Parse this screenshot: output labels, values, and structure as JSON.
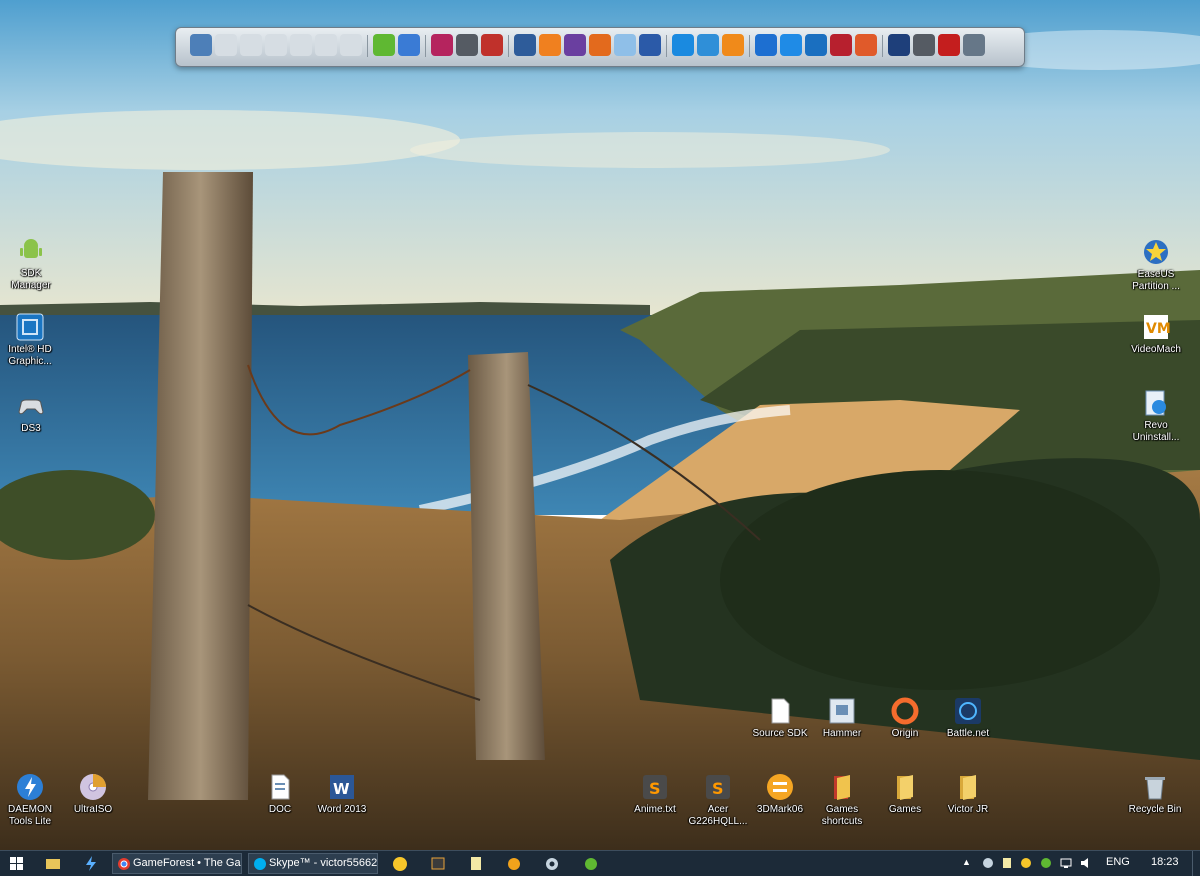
{
  "dock": {
    "icons": [
      "computer-icon",
      "drive-icon",
      "drive-icon",
      "drive-icon",
      "drive-icon",
      "drive-icon",
      "drive-icon",
      "utorrent-icon",
      "thunderbird-icon",
      "winamp-icon",
      "steam-icon",
      "anydvd-icon",
      "virtualbox-icon",
      "xampp-icon",
      "visual-studio-icon",
      "office-icon",
      "sandbox-icon",
      "save-icon",
      "zoom-icon",
      "clipboard-icon",
      "vlc-icon",
      "teamviewer-icon",
      "dropbox-icon",
      "phone-icon",
      "aida64-icon",
      "ccleaner-icon",
      "photoshop-icon",
      "camera-icon",
      "acrobat-icon",
      "monitor-icon"
    ]
  },
  "desktop": {
    "left": [
      {
        "label": "SDK Manager",
        "icon": "android-icon"
      },
      {
        "label": "Intel® HD\nGraphic...",
        "icon": "intel-hd-icon"
      },
      {
        "label": "DS3",
        "icon": "gamepad-icon"
      }
    ],
    "right": [
      {
        "label": "EaseUS\nPartition ...",
        "icon": "easeus-icon"
      },
      {
        "label": "VideoMach",
        "icon": "videomach-icon"
      },
      {
        "label": "Revo\nUninstall...",
        "icon": "revo-icon"
      }
    ],
    "row1": [
      {
        "label": "Source SDK",
        "icon": "document-icon"
      },
      {
        "label": "Hammer",
        "icon": "hammer-icon"
      },
      {
        "label": "Origin",
        "icon": "origin-icon"
      },
      {
        "label": "Battle.net",
        "icon": "battlenet-icon"
      }
    ],
    "row2": [
      {
        "label": "DAEMON\nTools Lite",
        "icon": "daemon-tools-icon"
      },
      {
        "label": "UltraISO",
        "icon": "ultraiso-icon"
      },
      {
        "label": "DOC",
        "icon": "doc-file-icon"
      },
      {
        "label": "Word 2013",
        "icon": "word-icon"
      },
      {
        "label": "Anime.txt",
        "icon": "sublime-icon"
      },
      {
        "label": "Acer\nG226HQLL...",
        "icon": "sublime-icon"
      },
      {
        "label": "3DMark06",
        "icon": "3dmark-icon"
      },
      {
        "label": "Games\nshortcuts",
        "icon": "folder-icon"
      },
      {
        "label": "Games",
        "icon": "folder-icon"
      },
      {
        "label": "Victor JR",
        "icon": "folder-icon"
      },
      {
        "label": "Recycle Bin",
        "icon": "recycle-bin-icon"
      }
    ]
  },
  "taskbar": {
    "chrome_title": "GameForest • The Ga...",
    "skype_title": "Skype™ - victor55662",
    "language": "ENG",
    "clock": "18:23"
  },
  "colors": {
    "taskbar": "#1c2a38",
    "sky": "#8cc0dd",
    "sea": "#2e6f9e",
    "sand": "#d8a868"
  }
}
